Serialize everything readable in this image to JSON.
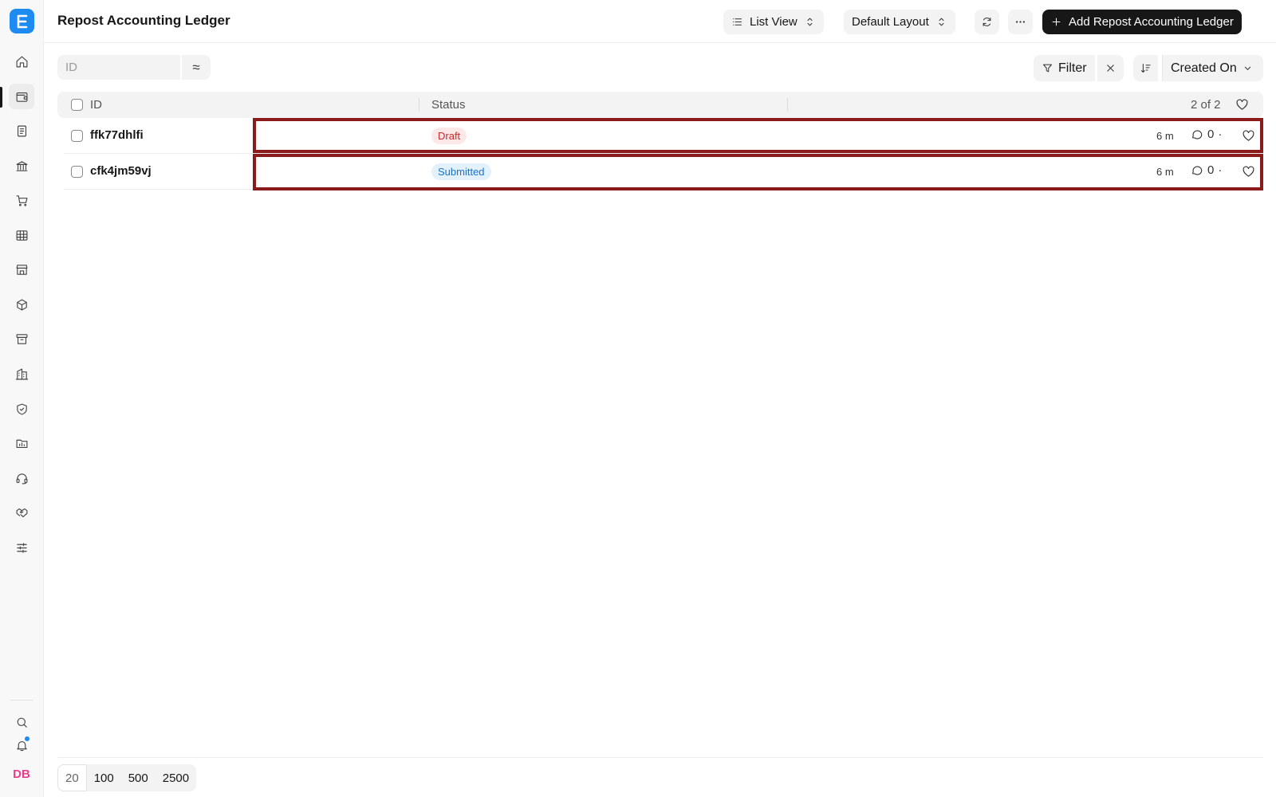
{
  "app": {
    "logo_letter": "E",
    "avatar_initials": "DB"
  },
  "sidebar": {
    "items": [
      {
        "name": "home-icon"
      },
      {
        "name": "wallet-icon",
        "active": true
      },
      {
        "name": "document-icon"
      },
      {
        "name": "bank-icon"
      },
      {
        "name": "cart-icon"
      },
      {
        "name": "table-icon"
      },
      {
        "name": "store-icon"
      },
      {
        "name": "package-icon"
      },
      {
        "name": "archive-icon"
      },
      {
        "name": "building-icon"
      },
      {
        "name": "shield-icon"
      },
      {
        "name": "folder-chart-icon"
      },
      {
        "name": "headset-icon"
      },
      {
        "name": "handshake-icon"
      },
      {
        "name": "sliders-icon"
      }
    ],
    "bottom": [
      {
        "name": "search-icon"
      },
      {
        "name": "bell-icon"
      }
    ]
  },
  "header": {
    "title": "Repost Accounting Ledger",
    "view_label": "List View",
    "layout_label": "Default Layout",
    "add_label": "Add Repost Accounting Ledger"
  },
  "toolbar": {
    "search_placeholder": "ID",
    "approx_symbol": "≈",
    "filter_label": "Filter",
    "sort_label": "Created On"
  },
  "table": {
    "columns": [
      "ID",
      "Status"
    ],
    "count": "2 of 2",
    "rows": [
      {
        "id": "ffk77dhlfi",
        "status": "Draft",
        "status_kind": "draft",
        "time": "6 m",
        "comments": "0"
      },
      {
        "id": "cfk4jm59vj",
        "status": "Submitted",
        "status_kind": "submitted",
        "time": "6 m",
        "comments": "0"
      }
    ]
  },
  "pagination": {
    "sizes": [
      "20",
      "100",
      "500",
      "2500"
    ],
    "selected": "20"
  },
  "colors": {
    "accent": "#1d8bf1",
    "draft": "#c92a2a",
    "submitted": "#1a73c8",
    "highlight": "#8b1a1a",
    "avatar": "#e83e8c"
  }
}
